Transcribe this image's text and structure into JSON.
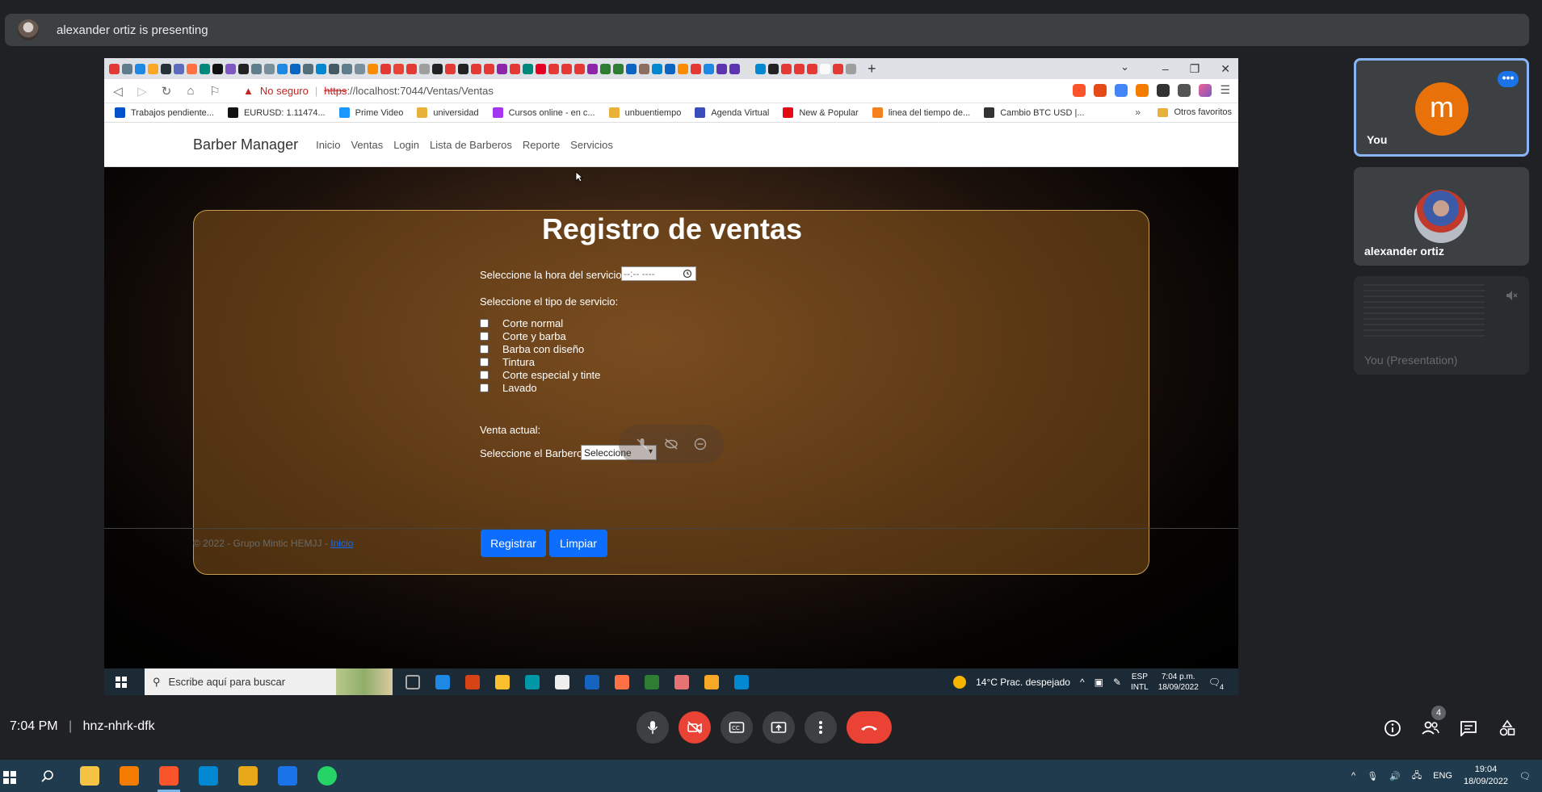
{
  "meet": {
    "presenting_text": "alexander ortiz is presenting",
    "time": "7:04 PM",
    "separator": "|",
    "meeting_code": "hnz-nhrk-dfk",
    "participants_badge": "4",
    "tiles": [
      {
        "name": "You",
        "initial": "m",
        "color": "#e8710a"
      },
      {
        "name": "alexander ortiz"
      },
      {
        "name": "You (Presentation)"
      }
    ],
    "controls": [
      "mic-icon",
      "camera-off-icon",
      "captions-icon",
      "present-icon",
      "more-icon",
      "end-call-icon"
    ],
    "right_controls": [
      "info-icon",
      "people-icon",
      "chat-icon",
      "activities-icon"
    ]
  },
  "browser": {
    "url_warning": "No seguro",
    "url_sep": "|",
    "url_scheme": "https",
    "url_rest": "://localhost:7044/Ventas/Ventas",
    "bookmarks": [
      {
        "label": "Trabajos pendiente...",
        "color": "#0052cc"
      },
      {
        "label": "EURUSD: 1.11474...",
        "color": "#111111"
      },
      {
        "label": "Prime Video",
        "color": "#1a98ff"
      },
      {
        "label": "universidad",
        "color": "#e8b23a"
      },
      {
        "label": "Cursos online - en c...",
        "color": "#a435f0"
      },
      {
        "label": "unbuentiempo",
        "color": "#e8b23a"
      },
      {
        "label": "Agenda Virtual",
        "color": "#3b4db8"
      },
      {
        "label": "New & Popular",
        "color": "#e50914"
      },
      {
        "label": "linea del tiempo de...",
        "color": "#f58220"
      },
      {
        "label": "Cambio BTC USD |...",
        "color": "#333333"
      }
    ],
    "bookmarks_more": "»",
    "other_bookmarks": "Otros favoritos"
  },
  "site": {
    "brand": "Barber Manager",
    "nav": [
      "Inicio",
      "Ventas",
      "Login",
      "Lista de Barberos",
      "Reporte",
      "Servicios"
    ],
    "title": "Registro de ventas",
    "time_label": "Seleccione la hora del servicio",
    "time_placeholder": "--:-- ----",
    "service_label": "Seleccione el tipo de servicio:",
    "services": [
      "Corte normal",
      "Corte y barba",
      "Barba con diseño",
      "Tintura",
      "Corte especial y tinte",
      "Lavado"
    ],
    "current_sale_label": "Venta actual:",
    "barber_label": "Seleccione el Barbero",
    "barber_select": "Seleccione",
    "register_button": "Registrar",
    "clear_button": "Limpiar",
    "footer_text": "© 2022 - Grupo Mintic HEMJJ - ",
    "footer_link": "Inicio"
  },
  "inner_taskbar": {
    "search_placeholder": "Escribe aquí para buscar",
    "weather": "14°C  Prac. despejado",
    "lang_1": "ESP",
    "lang_2": "INTL",
    "time": "7:04 p.m.",
    "date": "18/09/2022",
    "notif_count": "4"
  },
  "taskbar": {
    "lang": "ENG",
    "time": "19:04",
    "date": "18/09/2022"
  }
}
